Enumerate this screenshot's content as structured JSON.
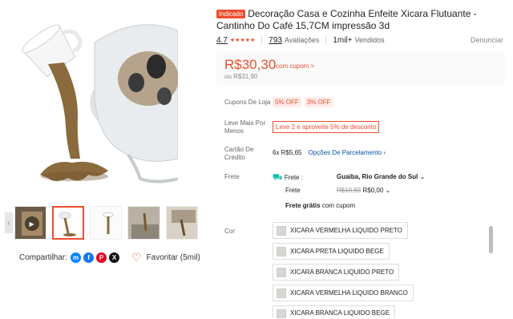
{
  "gallery": {
    "thumbs": [
      {
        "name": "thumb-video",
        "video": true
      },
      {
        "name": "thumb-2",
        "video": false
      },
      {
        "name": "thumb-3",
        "video": false
      },
      {
        "name": "thumb-4",
        "video": false
      },
      {
        "name": "thumb-5",
        "video": false
      }
    ],
    "share_label": "Compartilhar:",
    "favorite_label": "Favoritar (5mil)"
  },
  "product": {
    "badge": "Indicado",
    "title": "Decoração Casa e Cozinha Enfeite Xicara Flutuante - Cantinho Do Café 15,7CM impressão 3d",
    "rating": "4.7",
    "stars": "★★★★★",
    "reviews_count": "793",
    "reviews_label": "Avaliações",
    "sold_count": "1mil+",
    "sold_label": "Vendidos",
    "report_label": "Denunciar"
  },
  "price": {
    "current": "R$30,30",
    "coupon_note": "com cupom >",
    "original": "ou R$31,90"
  },
  "store_coupons": {
    "label": "Cupons De Loja",
    "chips": [
      "5% OFF",
      "3% OFF"
    ]
  },
  "bundle": {
    "label": "Leve Mais Por Menos",
    "promo": "Leve 2 e aproveite 5% de desconto"
  },
  "installments": {
    "label": "Cartão De Crédito",
    "count": "6x R$5,65",
    "link": "Opções De Parcelamento"
  },
  "shipping": {
    "label": "Frete",
    "to_label": "Frete :",
    "destination": "Guaiba, Rio Grande do Sul",
    "fee_label": "Frete",
    "fee_old": "R$10,83",
    "fee_new": "R$0,00",
    "free_bold": "Frete grátis",
    "free_rest": "com cupom"
  },
  "color": {
    "label": "Cor",
    "options": [
      "XICARA VERMELHA LIQUIDO PRETO",
      "XICARA PRETA LIQUIDO BEGE",
      "XICARA BRANCA LIQUIDO PRETO",
      "XICARA VERMELHA LIQUIDO BRANCO",
      "XICARA BRANCA LIQUIDO BEGE"
    ]
  },
  "colors": {
    "accent": "#ee4d2d",
    "link": "#0055aa",
    "shipping_icon": "#00bfa5"
  }
}
